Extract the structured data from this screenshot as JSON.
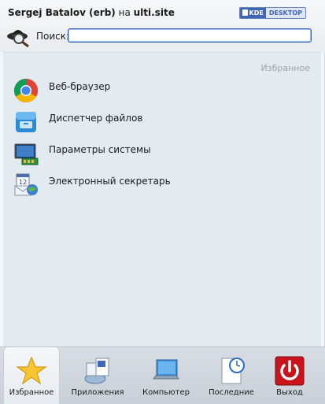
{
  "header": {
    "user_name": "Sergej Batalov (erb)",
    "host_sep": "на",
    "host": "ulti.site",
    "badge_left": "KDE",
    "badge_right": "DESKTOP"
  },
  "search": {
    "label": "Поиск:",
    "value": "",
    "placeholder": ""
  },
  "main": {
    "section_title": "Избранное",
    "items": [
      {
        "label": "Веб-браузер",
        "icon": "chrome-icon"
      },
      {
        "label": "Диспетчер файлов",
        "icon": "file-manager-icon"
      },
      {
        "label": "Параметры системы",
        "icon": "system-settings-icon"
      },
      {
        "label": "Электронный секретарь",
        "icon": "personal-organizer-icon"
      }
    ]
  },
  "tabs": [
    {
      "label": "Избранное",
      "icon": "star-icon",
      "active": true
    },
    {
      "label": "Приложения",
      "icon": "applications-icon",
      "active": false
    },
    {
      "label": "Компьютер",
      "icon": "computer-icon",
      "active": false
    },
    {
      "label": "Последние",
      "icon": "recent-document-icon",
      "active": false
    },
    {
      "label": "Выход",
      "icon": "power-icon",
      "active": false
    }
  ],
  "colors": {
    "accent": "#2f5fa8",
    "main_bg": "#e3eaf0",
    "logout_red": "#c8141a"
  }
}
